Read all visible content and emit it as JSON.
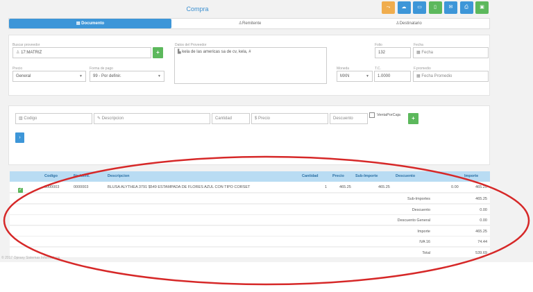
{
  "header": {
    "title": "Compra"
  },
  "toolbar": [
    {
      "icon": "share-icon",
      "glyph": "⤳",
      "color": "#f0ad4e"
    },
    {
      "icon": "cloud-icon",
      "glyph": "☁",
      "color": "#3d96d8"
    },
    {
      "icon": "card-icon",
      "glyph": "▭",
      "color": "#3d96d8"
    },
    {
      "icon": "file-icon",
      "glyph": "▯",
      "color": "#5cb85c"
    },
    {
      "icon": "mail-icon",
      "glyph": "✉",
      "color": "#3d96d8"
    },
    {
      "icon": "print-icon",
      "glyph": "⎙",
      "color": "#3d96d8"
    },
    {
      "icon": "save-icon",
      "glyph": "▣",
      "color": "#5cb85c"
    }
  ],
  "tabs": {
    "documento": "Documento",
    "remitente": "Remitente",
    "destinatario": "Destinatario"
  },
  "form": {
    "buscar_proveedor_label": "Buscar proveedor",
    "buscar_proveedor_value": "17:MATRIZ",
    "datos_proveedor_label": "Datos del Proveedor",
    "datos_proveedor_value": "kela de las americas sa de cv, kela,  #",
    "folio_label": "Folio",
    "folio_value": "132",
    "fecha_label": "Fecha",
    "fecha_placeholder": "Fecha",
    "precio_label": "Precio",
    "precio_value": "General",
    "forma_pago_label": "Forma de pago",
    "forma_pago_value": "99 - Por definir.",
    "moneda_label": "Moneda",
    "moneda_value": "MXN",
    "tc_label": "T.C.",
    "tc_value": "1.0000",
    "fpromedio_label": "F.promedio",
    "fpromedio_placeholder": "Fecha Promedio"
  },
  "line_entry": {
    "codigo": "Codigo",
    "descripcion": "Descripcion",
    "cantidad": "Cantidad",
    "precio": "Precio",
    "descuento": "Descuento",
    "venta_por_caja": "VentaPorCaja"
  },
  "table": {
    "headers": {
      "codigo": "Codigo",
      "no_ident": "No.Ident.",
      "descripcion": "Descripcion",
      "cantidad": "Cantidad",
      "precio": "Precio",
      "sub_importe": "Sub-Importe",
      "descuento": "Descuento",
      "importe": "Importe"
    },
    "rows": [
      {
        "codigo": "0000003",
        "no_ident": "0000003",
        "descripcion": "BLUSA ALYTHEA 3791 $549 ESTAMPADA DE FLORES AZUL CON TIPO CORSET",
        "cantidad": "1",
        "precio": "465.25",
        "sub_importe": "465.25",
        "descuento": "0.00",
        "importe": "465.25"
      }
    ],
    "summary": [
      {
        "label": "Sub-Importes",
        "value": "465.25"
      },
      {
        "label": "Descuento",
        "value": "0.00"
      },
      {
        "label": "Descuento General",
        "value": "0.00"
      },
      {
        "label": "Importe",
        "value": "465.25"
      },
      {
        "label": "IVA 16",
        "value": "74.44"
      },
      {
        "label": "Total",
        "value": "539.69"
      }
    ]
  },
  "footer": {
    "text": "© 2017 Opravy Sistemas Informaticos"
  },
  "annotation": {
    "color": "#d62828"
  }
}
